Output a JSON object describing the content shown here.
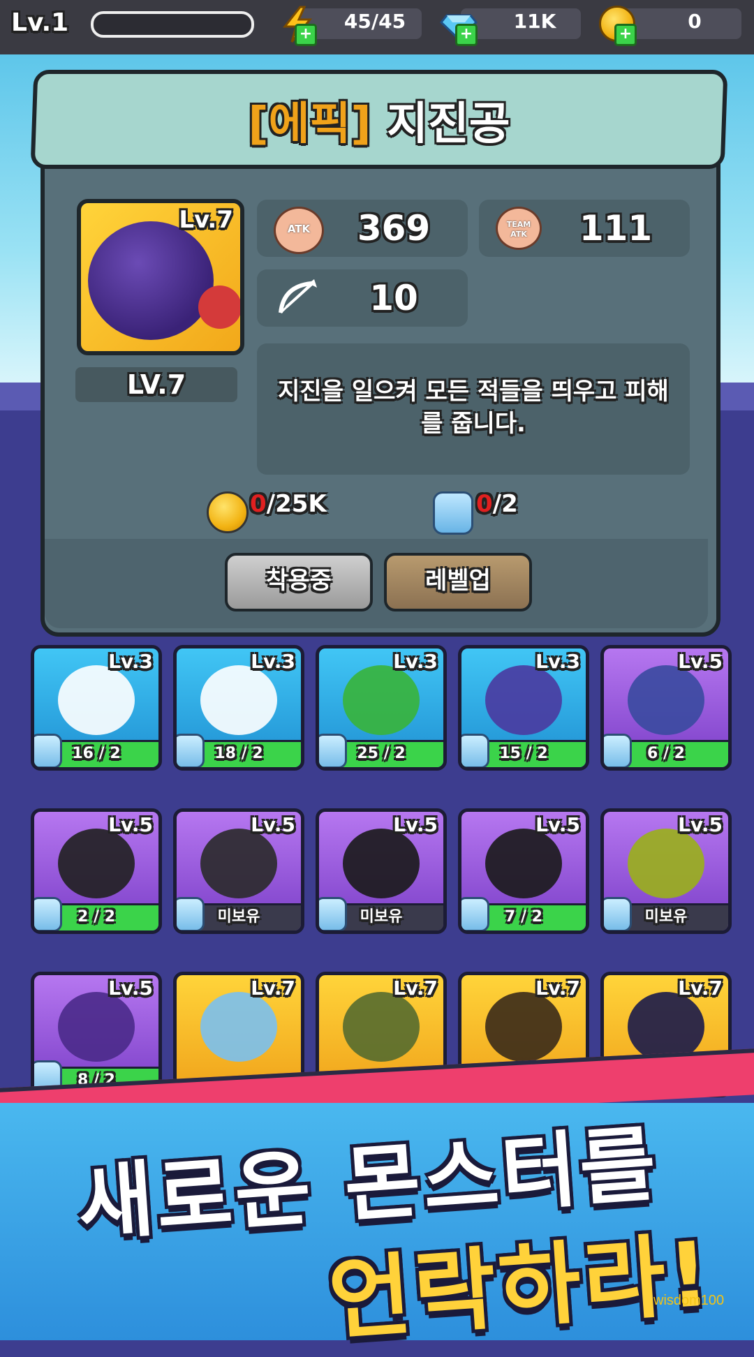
{
  "topbar": {
    "level": "Lv.1",
    "energy": "45/45",
    "gems": "11K",
    "gold": "0"
  },
  "popup": {
    "title_tag": "[에픽]",
    "title_name": "지진공",
    "portrait_level": "Lv.7",
    "level_label": "LV.7",
    "atk_icon_text": "ATK",
    "atk": "369",
    "team_atk_icon_text": "TEAM ATK",
    "team_atk": "111",
    "range": "10",
    "description": "지진을 일으켜 모든 적들을 띄우고 피해를 줍니다.",
    "gold_cost_have": "0",
    "gold_cost_need": "/25K",
    "shard_cost_have": "0",
    "shard_cost_need": "/2",
    "equipped_label": "착용중",
    "levelup_label": "레벨업"
  },
  "monsters": [
    {
      "level": "Lv.3",
      "progress": "16 / 2",
      "bg": "blue"
    },
    {
      "level": "Lv.3",
      "progress": "18 / 2",
      "bg": "blue"
    },
    {
      "level": "Lv.3",
      "progress": "25 / 2",
      "bg": "blue"
    },
    {
      "level": "Lv.3",
      "progress": "15 / 2",
      "bg": "blue"
    },
    {
      "level": "Lv.5",
      "progress": "6 / 2",
      "bg": "purple"
    },
    {
      "level": "Lv.5",
      "progress": "2 / 2",
      "bg": "purple"
    },
    {
      "level": "Lv.5",
      "progress": "미보유",
      "bg": "purple"
    },
    {
      "level": "Lv.5",
      "progress": "미보유",
      "bg": "purple"
    },
    {
      "level": "Lv.5",
      "progress": "7 / 2",
      "bg": "purple"
    },
    {
      "level": "Lv.5",
      "progress": "미보유",
      "bg": "purple"
    },
    {
      "level": "Lv.5",
      "progress": "8 / 2",
      "bg": "purple"
    },
    {
      "level": "Lv.7",
      "progress": "",
      "bg": "yellow"
    },
    {
      "level": "Lv.7",
      "progress": "",
      "bg": "yellow"
    },
    {
      "level": "Lv.7",
      "progress": "",
      "bg": "yellow"
    },
    {
      "level": "Lv.7",
      "progress": "",
      "bg": "yellow"
    }
  ],
  "banner": {
    "line1": "새로운 몬스터를",
    "line2": "언락하라!"
  },
  "watermark": "wisdom100"
}
